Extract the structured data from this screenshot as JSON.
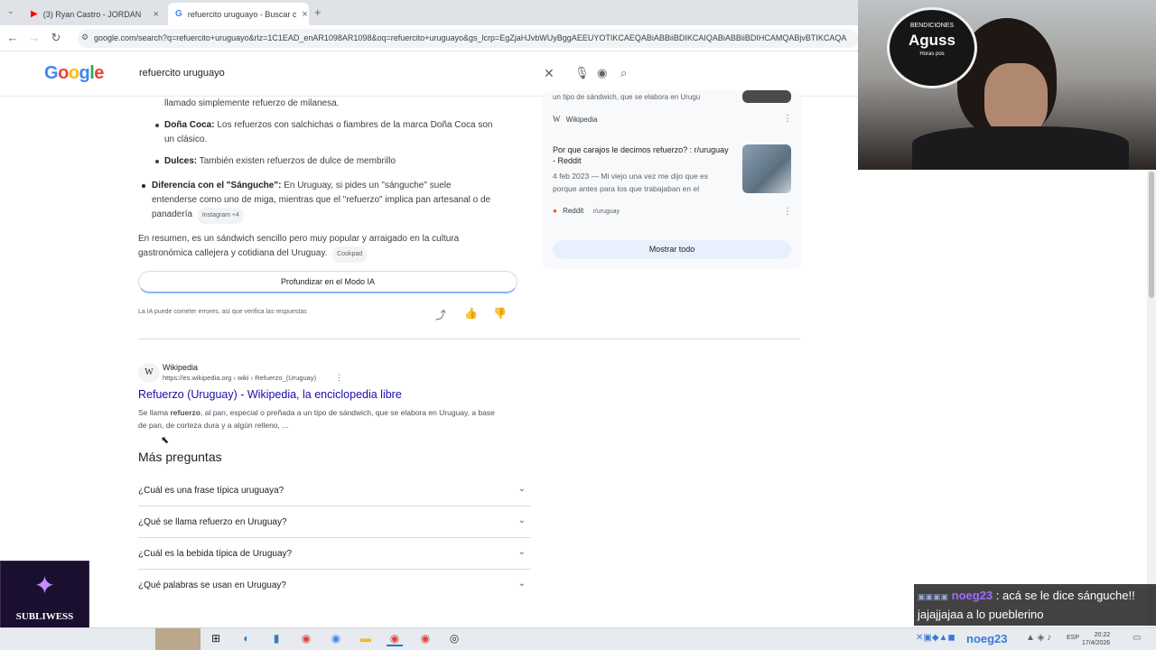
{
  "browser": {
    "tabs": [
      {
        "title": "(3) Ryan Castro - JORDAN"
      },
      {
        "title": "refuercito uruguayo - Buscar c"
      }
    ],
    "url": "google.com/search?q=refuercito+uruguayo&rlz=1C1EAD_enAR1098AR1098&oq=refuercito+uruguayo&gs_lcrp=EgZjaHJvbWUyBggAEEUYOTIKCAEQABiABBiiBDIKCAIQABiABBiiBDIHCAMQABjvBTIKCAQA"
  },
  "google": {
    "logo": "Google",
    "search_query": "refuercito uruguayo"
  },
  "ai_overview": {
    "line_milanesa": "llamado simplemente refuerzo de milanesa.",
    "dona_coca_label": "Doña Coca:",
    "dona_coca_text1": "Los refuerzos con salchichas o fiambres de la marca Doña Coca son",
    "dona_coca_text2": "un clásico.",
    "dulces_label": "Dulces:",
    "dulces_text": "También existen refuerzos de dulce de membrillo",
    "diferencia_label": "Diferencia con el \"Sánguche\":",
    "diferencia_text1": "En Uruguay, si pides un \"sánguche\" suele",
    "diferencia_text2": "entenderse como uno de miga, mientras que el \"refuerzo\" implica pan artesanal o de",
    "diferencia_text3": "panadería",
    "diferencia_chip": "Instagram +4",
    "summary1": "En resumen, es un sándwich sencillo pero muy popular y arraigado en la cultura",
    "summary2": "gastronómica callejera y cotidiana del Uruguay.",
    "summary_chip": "Cookpad",
    "deepen_button": "Profundizar en el Modo IA",
    "disclaimer": "La IA puede cometer errores, así que verifica las respuestas"
  },
  "sources_panel": {
    "top_snippet": "un tipo de sándwich, que se elabora en Urugu",
    "top_source": "Wikipedia",
    "reddit_title1": "Por que carajos le decimos refuerzo? : r/uruguay",
    "reddit_title2": "- Reddit",
    "reddit_date": "4 feb 2023",
    "reddit_snippet1": "— Mi viejo una vez me dijo que es",
    "reddit_snippet2": "porque antes para los que trabajaban en el",
    "reddit_source": "Reddit",
    "reddit_sub": "r/uruguay",
    "show_all": "Mostrar todo"
  },
  "result": {
    "site_name": "Wikipedia",
    "site_url": "https://es.wikipedia.org › wiki › Refuerzo_(Uruguay)",
    "title": "Refuerzo (Uruguay) - Wikipedia, la enciclopedia libre",
    "snippet1_pre": "Se llama",
    "snippet1_bold": "refuerzo",
    "snippet1_post": ", al pan, especial o preñada a un tipo de sándwich, que se elabora en Uruguay, a base",
    "snippet2": "de pan, de corteza dura y a algún relleno, ..."
  },
  "paa": {
    "heading": "Más preguntas",
    "questions": [
      "¿Cuál es una frase típica uruguaya?",
      "¿Qué se llama refuerzo en Uruguay?",
      "¿Cuál es la bebida típica de Uruguay?",
      "¿Qué palabras se usan en Uruguay?"
    ]
  },
  "stream": {
    "badge_top": "BENDICIONES",
    "badge_name": "Aguss",
    "badge_bottom": "Horas pos",
    "overlay_logo": "SUBLIWESS",
    "chat_user": "noeg23",
    "chat_message": ": acá se le dice sánguche!! jajajjajaa a lo pueblerino",
    "chat_user_2": "noeg23"
  },
  "taskbar": {
    "lang": "ESP",
    "time": "20:22",
    "date": "17/4/2026"
  }
}
